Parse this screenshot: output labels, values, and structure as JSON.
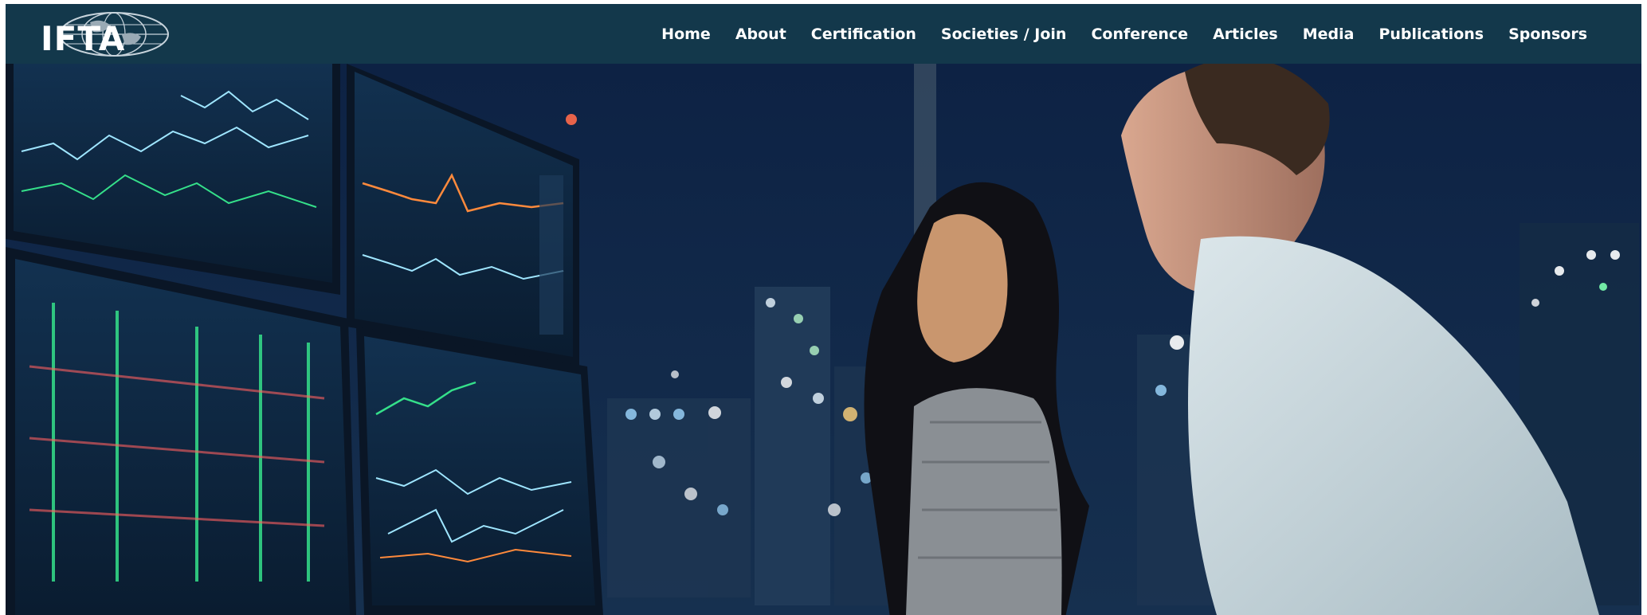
{
  "header": {
    "logo_text": "IFTA",
    "nav": [
      {
        "label": "Home"
      },
      {
        "label": "About"
      },
      {
        "label": "Certification"
      },
      {
        "label": "Societies / Join"
      },
      {
        "label": "Conference"
      },
      {
        "label": "Articles"
      },
      {
        "label": "Media"
      },
      {
        "label": "Publications"
      },
      {
        "label": "Sponsors"
      }
    ]
  },
  "colors": {
    "header_bg": "#13384b",
    "hero_bg": "#0c1d33",
    "chart_green": "#35e08a",
    "chart_cyan": "#9fe6ff",
    "chart_orange": "#ff8a3c"
  }
}
